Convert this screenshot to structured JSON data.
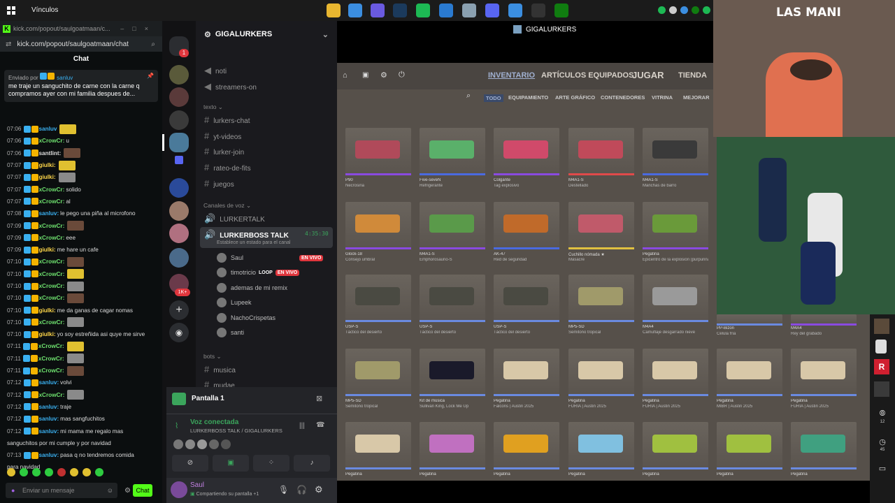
{
  "taskbar": {
    "title": "Vínculos",
    "apps": [
      {
        "icon": "folder-icon",
        "color": "#e8b630"
      },
      {
        "icon": "chrome-icon",
        "color": "#3b8ee0"
      },
      {
        "icon": "copilot-icon",
        "color": "#6a5ae0"
      },
      {
        "icon": "steam-icon",
        "color": "#1b3a5c"
      },
      {
        "icon": "spotify-icon",
        "color": "#1db954"
      },
      {
        "icon": "store-icon",
        "color": "#2a7ad0"
      },
      {
        "icon": "explorer-icon",
        "color": "#8aa0b0"
      },
      {
        "icon": "discord-icon",
        "color": "#5865f2"
      },
      {
        "icon": "chrome-icon",
        "color": "#3b8ee0"
      },
      {
        "icon": "obs-icon",
        "color": "#333333"
      },
      {
        "icon": "xbox-icon",
        "color": "#107c10"
      }
    ]
  },
  "kick": {
    "url": "kick.com/popout/saulgoatmaan/chat",
    "tab_url": "kick.com/popout/saulgoatmaan/c...",
    "chat_label": "Chat",
    "pinned_by": "Enviado por",
    "pinned_user": "sanluv",
    "pinned_text": "me traje un sanguchito de carne con la carne q compramos ayer con mi familia despues de...",
    "input_placeholder": "Enviar un mensaje",
    "chat_button": "Chat",
    "messages": [
      {
        "t": "07:06",
        "u": "sanluv",
        "c": "#3ab0f0",
        "m": ""
      },
      {
        "t": "07:06",
        "u": "xCrowCr:",
        "c": "#6ee06e",
        "m": "u"
      },
      {
        "t": "07:06",
        "u": "santlint:",
        "c": "#ddd",
        "m": ""
      },
      {
        "t": "07:07",
        "u": "giulki:",
        "c": "#ffd84a",
        "m": ""
      },
      {
        "t": "07:07",
        "u": "giulki:",
        "c": "#ffd84a",
        "m": ""
      },
      {
        "t": "07:07",
        "u": "xCrowCr:",
        "c": "#6ee06e",
        "m": "solido"
      },
      {
        "t": "07:07",
        "u": "xCrowCr:",
        "c": "#6ee06e",
        "m": "al"
      },
      {
        "t": "07:08",
        "u": "sanluv:",
        "c": "#3ab0f0",
        "m": "le pego una piña al microfono"
      },
      {
        "t": "07:09",
        "u": "xCrowCr:",
        "c": "#6ee06e",
        "m": ""
      },
      {
        "t": "07:09",
        "u": "xCrowCr:",
        "c": "#6ee06e",
        "m": "eee"
      },
      {
        "t": "07:09",
        "u": "giulki:",
        "c": "#ffd84a",
        "m": "me hare un cafe"
      },
      {
        "t": "07:10",
        "u": "xCrowCr:",
        "c": "#6ee06e",
        "m": ""
      },
      {
        "t": "07:10",
        "u": "xCrowCr:",
        "c": "#6ee06e",
        "m": ""
      },
      {
        "t": "07:10",
        "u": "xCrowCr:",
        "c": "#6ee06e",
        "m": ""
      },
      {
        "t": "07:10",
        "u": "xCrowCr:",
        "c": "#6ee06e",
        "m": ""
      },
      {
        "t": "07:10",
        "u": "giulki:",
        "c": "#ffd84a",
        "m": "me da ganas de cagar nomas"
      },
      {
        "t": "07:10",
        "u": "xCrowCr:",
        "c": "#6ee06e",
        "m": ""
      },
      {
        "t": "07:10",
        "u": "giulki:",
        "c": "#ffd84a",
        "m": "yo soy estreñida asi quye me sirve"
      },
      {
        "t": "07:11",
        "u": "xCrowCr:",
        "c": "#6ee06e",
        "m": ""
      },
      {
        "t": "07:11",
        "u": "xCrowCr:",
        "c": "#6ee06e",
        "m": ""
      },
      {
        "t": "07:11",
        "u": "xCrowCr:",
        "c": "#6ee06e",
        "m": ""
      },
      {
        "t": "07:12",
        "u": "sanluv:",
        "c": "#3ab0f0",
        "m": "volvi"
      },
      {
        "t": "07:12",
        "u": "xCrowCr:",
        "c": "#6ee06e",
        "m": ""
      },
      {
        "t": "07:12",
        "u": "sanluv:",
        "c": "#3ab0f0",
        "m": "traje"
      },
      {
        "t": "07:12",
        "u": "sanluv:",
        "c": "#3ab0f0",
        "m": "mas sangfuchitos"
      },
      {
        "t": "07:12",
        "u": "sanluv:",
        "c": "#3ab0f0",
        "m": "mi mama me regalo mas"
      },
      {
        "t": "",
        "u": "",
        "c": "#ddd",
        "m": "sanguchitos por mi cumple y por navidad"
      },
      {
        "t": "07:13",
        "u": "sanluv:",
        "c": "#3ab0f0",
        "m": "pasa q no tendremos comida"
      },
      {
        "t": "",
        "u": "",
        "c": "#ddd",
        "m": "para navidad"
      }
    ]
  },
  "discord": {
    "server_name": "GIGALURKERS",
    "window_title": "GIGALURKERS",
    "badge_count": "1",
    "badge_1k": "1K+",
    "channels_top": [
      "noti",
      "streamers-on"
    ],
    "cat_text": "texto",
    "text_channels": [
      "lurkers-chat",
      "yt-videos",
      "lurker-join",
      "rateo-de-fits",
      "juegos"
    ],
    "cat_voice": "Canales de voz",
    "voice_channels": [
      "LURKERTALK",
      "LURKERBOSS TALK"
    ],
    "voice_timer": "4:35:30",
    "voice_status": "Establece un estado para el canal",
    "voice_users": [
      {
        "name": "Saul",
        "live": "EN VIVO"
      },
      {
        "name": "timotricio",
        "extra": "LOOP",
        "live": "EN VIVO"
      },
      {
        "name": "ademas de mi remix",
        "live": ""
      },
      {
        "name": "Lupeek",
        "live": ""
      },
      {
        "name": "NachoCrispetas",
        "live": ""
      },
      {
        "name": "santi",
        "live": ""
      }
    ],
    "cat_bots": "bots",
    "bot_channels": [
      "musica",
      "mudae"
    ],
    "screen_title": "Pantalla 1",
    "voice_connected": "Voz conectada",
    "voice_path": "LURKERBOSS TALK / GIGALURKERS",
    "user_name": "Saul",
    "user_status": "Compartiendo su pantalla +1"
  },
  "game": {
    "nav": [
      "INVENTARIO",
      "ARTÍCULOS EQUIPADOS",
      "JUGAR",
      "TIENDA"
    ],
    "filters": [
      "TODO",
      "EQUIPAMIENTO",
      "ARTE GRÁFICO",
      "CONTENEDORES",
      "VITRINA",
      "MEJORAR"
    ],
    "items": [
      {
        "n": "P90",
        "s": "Necrosina",
        "col": "#b04a5a",
        "rar": "#8a4ae0"
      },
      {
        "n": "Five-seveN",
        "s": "Refrigerante",
        "col": "#5ab06a",
        "rar": "#4a6ae0"
      },
      {
        "n": "Colgante",
        "s": "Tag explosivo",
        "col": "#d04a6a",
        "rar": "#8a4ae0"
      },
      {
        "n": "M4A1-S",
        "s": "Destellado",
        "col": "#c04a5a",
        "rar": "#e04a4a"
      },
      {
        "n": "M4A1-S",
        "s": "Manchas de barro",
        "col": "#3a3a3a",
        "rar": "#4a6ae0"
      },
      {
        "n": "Glock-18",
        "s": "Consejo umbral",
        "col": "#d08a3a",
        "rar": "#8a4ae0"
      },
      {
        "n": "M4A1-S",
        "s": "Emphorosaurio-S",
        "col": "#5a9a4a",
        "rar": "#8a4ae0"
      },
      {
        "n": "AK-47",
        "s": "Red de seguridad",
        "col": "#c06a2a",
        "rar": "#4a6ae0"
      },
      {
        "n": "Cuchillo nómada ★",
        "s": "Masacre",
        "col": "#c05a6a",
        "rar": "#e0c040"
      },
      {
        "n": "Pegatina",
        "s": "Epicentro de la explosión (purpurina)",
        "col": "#6a9a3a",
        "rar": "#8a4ae0"
      },
      {
        "n": "USP-S",
        "s": "Táctico del desierto",
        "col": "#4a4a42",
        "rar": "#6a8ae0"
      },
      {
        "n": "USP-S",
        "s": "Táctico del desierto",
        "col": "#4a4a42",
        "rar": "#6a8ae0"
      },
      {
        "n": "USP-S",
        "s": "Táctico del desierto",
        "col": "#4a4a42",
        "rar": "#6a8ae0"
      },
      {
        "n": "MP5-SD",
        "s": "Semitono tropical",
        "col": "#a09a6a",
        "rar": "#6a8ae0"
      },
      {
        "n": "M4A4",
        "s": "Camuflaje desgarrado nieve",
        "col": "#9a9a9a",
        "rar": "#6a8ae0"
      },
      {
        "n": "MP5-SD",
        "s": "Semitono tropical",
        "col": "#a09a6a",
        "rar": "#6a8ae0"
      },
      {
        "n": "Kit de música",
        "s": "Sullivan King, Lock Me Up",
        "col": "#1a1a2a",
        "rar": "#6a8ae0"
      },
      {
        "n": "Pegatina",
        "s": "Falcons | Austin 2025",
        "col": "#d8c8a8",
        "rar": "#6a8ae0"
      },
      {
        "n": "Pegatina",
        "s": "FURIA | Austin 2025",
        "col": "#d8c8a8",
        "rar": "#6a8ae0"
      },
      {
        "n": "Pegatina",
        "s": "FURIA | Austin 2025",
        "col": "#d8c8a8",
        "rar": "#6a8ae0"
      },
      {
        "n": "Pegatina",
        "s": "MIBR | Austin 2025",
        "col": "#d8c8a8",
        "rar": "#6a8ae0"
      },
      {
        "n": "Pegatina",
        "s": "FURIA | Austin 2025",
        "col": "#d8c8a8",
        "rar": "#6a8ae0"
      },
      {
        "n": "Pegatina",
        "s": "",
        "col": "#d8c8a8",
        "rar": "#6a8ae0"
      },
      {
        "n": "Pegatina",
        "s": "",
        "col": "#c070c0",
        "rar": "#6a8ae0"
      },
      {
        "n": "Pegatina",
        "s": "",
        "col": "#e0a020",
        "rar": "#6a8ae0"
      },
      {
        "n": "Pegatina",
        "s": "",
        "col": "#80c0e0",
        "rar": "#6a8ae0"
      },
      {
        "n": "Pegatina",
        "s": "",
        "col": "#a0c040",
        "rar": "#6a8ae0"
      },
      {
        "n": "Pegatina",
        "s": "",
        "col": "#a0c040",
        "rar": "#6a8ae0"
      },
      {
        "n": "Pegatina",
        "s": "",
        "col": "#40a080",
        "rar": "#6a8ae0"
      }
    ],
    "extra_items": [
      {
        "n": "PP-Bizon",
        "s": "Célula fría"
      },
      {
        "n": "M4A4",
        "s": "Rey del grabado"
      }
    ]
  },
  "overlay": {
    "cam_title": "LAS MANI",
    "side_counts": [
      "12",
      "45"
    ]
  }
}
